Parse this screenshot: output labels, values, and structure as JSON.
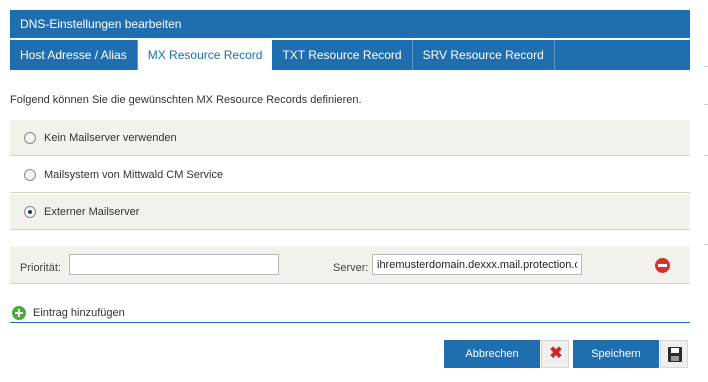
{
  "dialog": {
    "title": "DNS-Einstellungen bearbeiten"
  },
  "tabs": [
    {
      "label": "Host Adresse / Alias",
      "active": false
    },
    {
      "label": "MX Resource Record",
      "active": true
    },
    {
      "label": "TXT Resource Record",
      "active": false
    },
    {
      "label": "SRV Resource Record",
      "active": false
    }
  ],
  "intro_text": "Folgend können Sie die gewünschten MX Resource Records definieren.",
  "options": [
    {
      "label": "Kein Mailserver verwenden",
      "checked": false
    },
    {
      "label": "Mailsystem von Mittwald CM Service",
      "checked": false
    },
    {
      "label": "Externer Mailserver",
      "checked": true
    }
  ],
  "mx_record": {
    "priority_label": "Priorität:",
    "priority_value": "",
    "server_label": "Server:",
    "server_value": "ihremusterdomain.dexxx.mail.protection.outlook.com"
  },
  "add_entry_label": "Eintrag hinzufügen",
  "buttons": {
    "cancel_label": "Abbrechen",
    "save_label": "Speichern"
  },
  "colors": {
    "primary": "#1f6eb0",
    "row_background": "#f3f1ec",
    "remove": "#d9302c",
    "add": "#4caa3a",
    "cancel_icon": "#c8282a"
  }
}
